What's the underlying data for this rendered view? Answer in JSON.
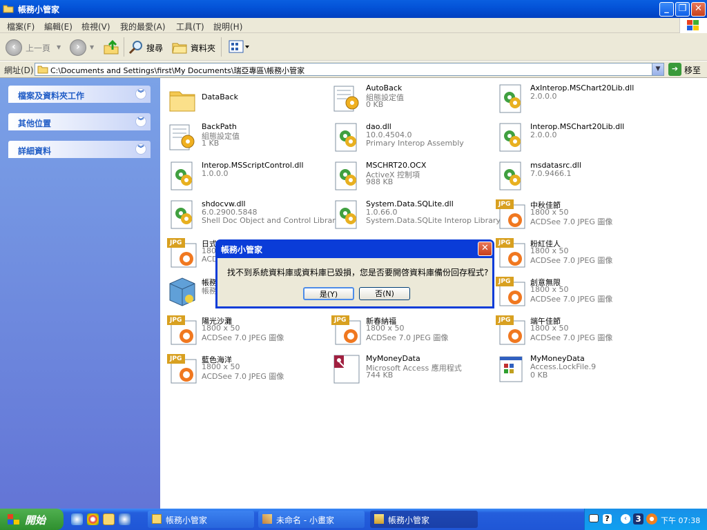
{
  "window": {
    "title": "帳務小管家"
  },
  "menu": [
    "檔案(F)",
    "編輯(E)",
    "檢視(V)",
    "我的最愛(A)",
    "工具(T)",
    "說明(H)"
  ],
  "toolbar": {
    "back": "上一頁",
    "search": "搜尋",
    "folders": "資料夾"
  },
  "address": {
    "label": "網址(D)",
    "path": "C:\\Documents and Settings\\first\\My Documents\\瑞亞專區\\帳務小管家",
    "go": "移至"
  },
  "taskpane": {
    "panels": [
      "檔案及資料夾工作",
      "其他位置",
      "詳細資料"
    ]
  },
  "files": [
    {
      "name": "DataBack",
      "l2": "",
      "l3": "",
      "icon": "folder"
    },
    {
      "name": "AutoBack",
      "l2": "組態設定值",
      "l3": "0 KB",
      "icon": "config"
    },
    {
      "name": "AxInterop.MSChart20Lib.dll",
      "l2": "2.0.0.0",
      "l3": "",
      "icon": "dll"
    },
    {
      "name": "BackPath",
      "l2": "組態設定值",
      "l3": "1 KB",
      "icon": "config"
    },
    {
      "name": "dao.dll",
      "l2": "10.0.4504.0",
      "l3": "Primary Interop Assembly",
      "icon": "dll"
    },
    {
      "name": "Interop.MSChart20Lib.dll",
      "l2": "2.0.0.0",
      "l3": "",
      "icon": "dll"
    },
    {
      "name": "Interop.MSScriptControl.dll",
      "l2": "1.0.0.0",
      "l3": "",
      "icon": "dll"
    },
    {
      "name": "MSCHRT20.OCX",
      "l2": "ActiveX 控制項",
      "l3": "988 KB",
      "icon": "dll"
    },
    {
      "name": "msdatasrc.dll",
      "l2": "7.0.9466.1",
      "l3": "",
      "icon": "dll"
    },
    {
      "name": "shdocvw.dll",
      "l2": "6.0.2900.5848",
      "l3": "Shell Doc Object and Control Library",
      "icon": "dll"
    },
    {
      "name": "System.Data.SQLite.dll",
      "l2": "1.0.66.0",
      "l3": "System.Data.SQLite Interop Library",
      "icon": "dll"
    },
    {
      "name": "中秋佳節",
      "l2": "1800 x 50",
      "l3": "ACDSee 7.0 JPEG 圖像",
      "icon": "jpg"
    },
    {
      "name": "日式",
      "l2": "1800",
      "l3": "ACD",
      "icon": "jpg"
    },
    {
      "name": "",
      "l2": "",
      "l3": "",
      "icon": "none"
    },
    {
      "name": "粉紅佳人",
      "l2": "1800 x 50",
      "l3": "ACDSee 7.0 JPEG 圖像",
      "icon": "jpg"
    },
    {
      "name": "帳務",
      "l2": "帳務",
      "l3": "",
      "icon": "app"
    },
    {
      "name": "",
      "l2": "",
      "l3": "",
      "icon": "none"
    },
    {
      "name": "創意無限",
      "l2": "1800 x 50",
      "l3": "ACDSee 7.0 JPEG 圖像",
      "icon": "jpg"
    },
    {
      "name": "陽光沙灘",
      "l2": "1800 x 50",
      "l3": "ACDSee 7.0 JPEG 圖像",
      "icon": "jpg"
    },
    {
      "name": "新春納福",
      "l2": "1800 x 50",
      "l3": "ACDSee 7.0 JPEG 圖像",
      "icon": "jpg"
    },
    {
      "name": "端午佳節",
      "l2": "1800 x 50",
      "l3": "ACDSee 7.0 JPEG 圖像",
      "icon": "jpg"
    },
    {
      "name": "藍色海洋",
      "l2": "1800 x 50",
      "l3": "ACDSee 7.0 JPEG 圖像",
      "icon": "jpg"
    },
    {
      "name": "MyMoneyData",
      "l2": "Microsoft Access 應用程式",
      "l3": "744 KB",
      "icon": "access"
    },
    {
      "name": "MyMoneyData",
      "l2": "Access.LockFile.9",
      "l3": "0 KB",
      "icon": "lock"
    }
  ],
  "icon_text": {
    "jpg": "JPG"
  },
  "dialog": {
    "title": "帳務小管家",
    "message": "找不到系統資料庫或資料庫已毀損，您是否要開啓資料庫備份回存程式?",
    "yes": "是(Y)",
    "no": "否(N)"
  },
  "taskbar": {
    "start": "開始",
    "tasks": [
      "帳務小管家",
      "未命名 - 小畫家",
      "帳務小管家"
    ],
    "clock": "下午 07:38",
    "tray_number": "3"
  }
}
